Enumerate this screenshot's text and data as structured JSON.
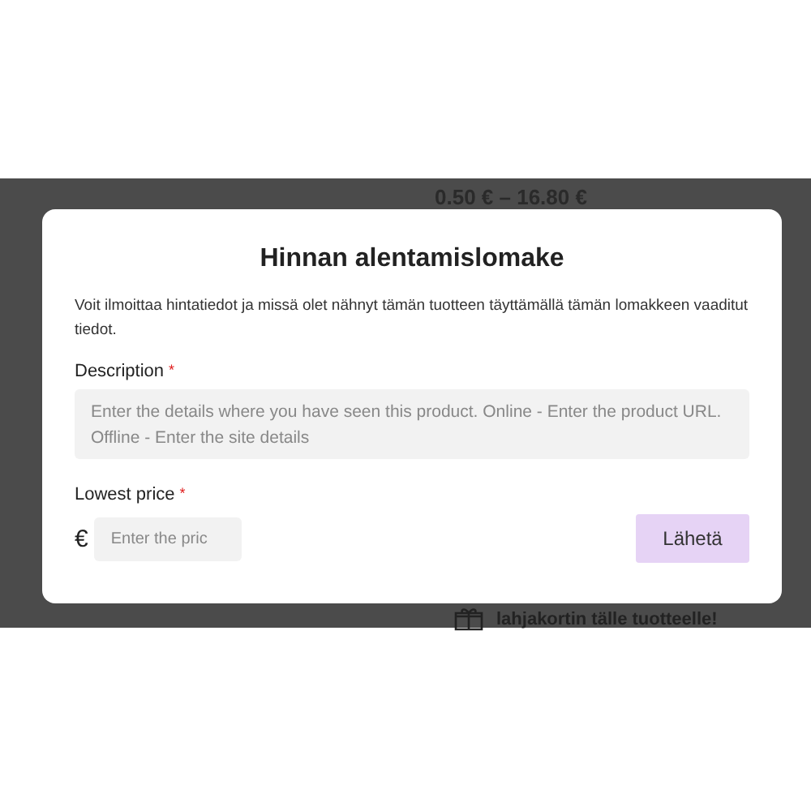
{
  "background": {
    "price_range": "0.50 € – 16.80 €",
    "gift_text": "lahjakortin tälle tuotteelle!"
  },
  "modal": {
    "title": "Hinnan alentamislomake",
    "intro": "Voit ilmoittaa hintatiedot ja missä olet nähnyt tämän tuotteen täyttämällä tämän lomakkeen vaaditut tiedot.",
    "fields": [
      {
        "label": "Description",
        "required_mark": "*",
        "placeholder": "Enter the details where you have seen this product. Online - Enter the product URL. Offline - Enter the site details"
      },
      {
        "label": "Lowest price",
        "required_mark": "*",
        "currency": "€",
        "placeholder": "Enter the pric"
      }
    ],
    "submit": "Lähetä"
  }
}
